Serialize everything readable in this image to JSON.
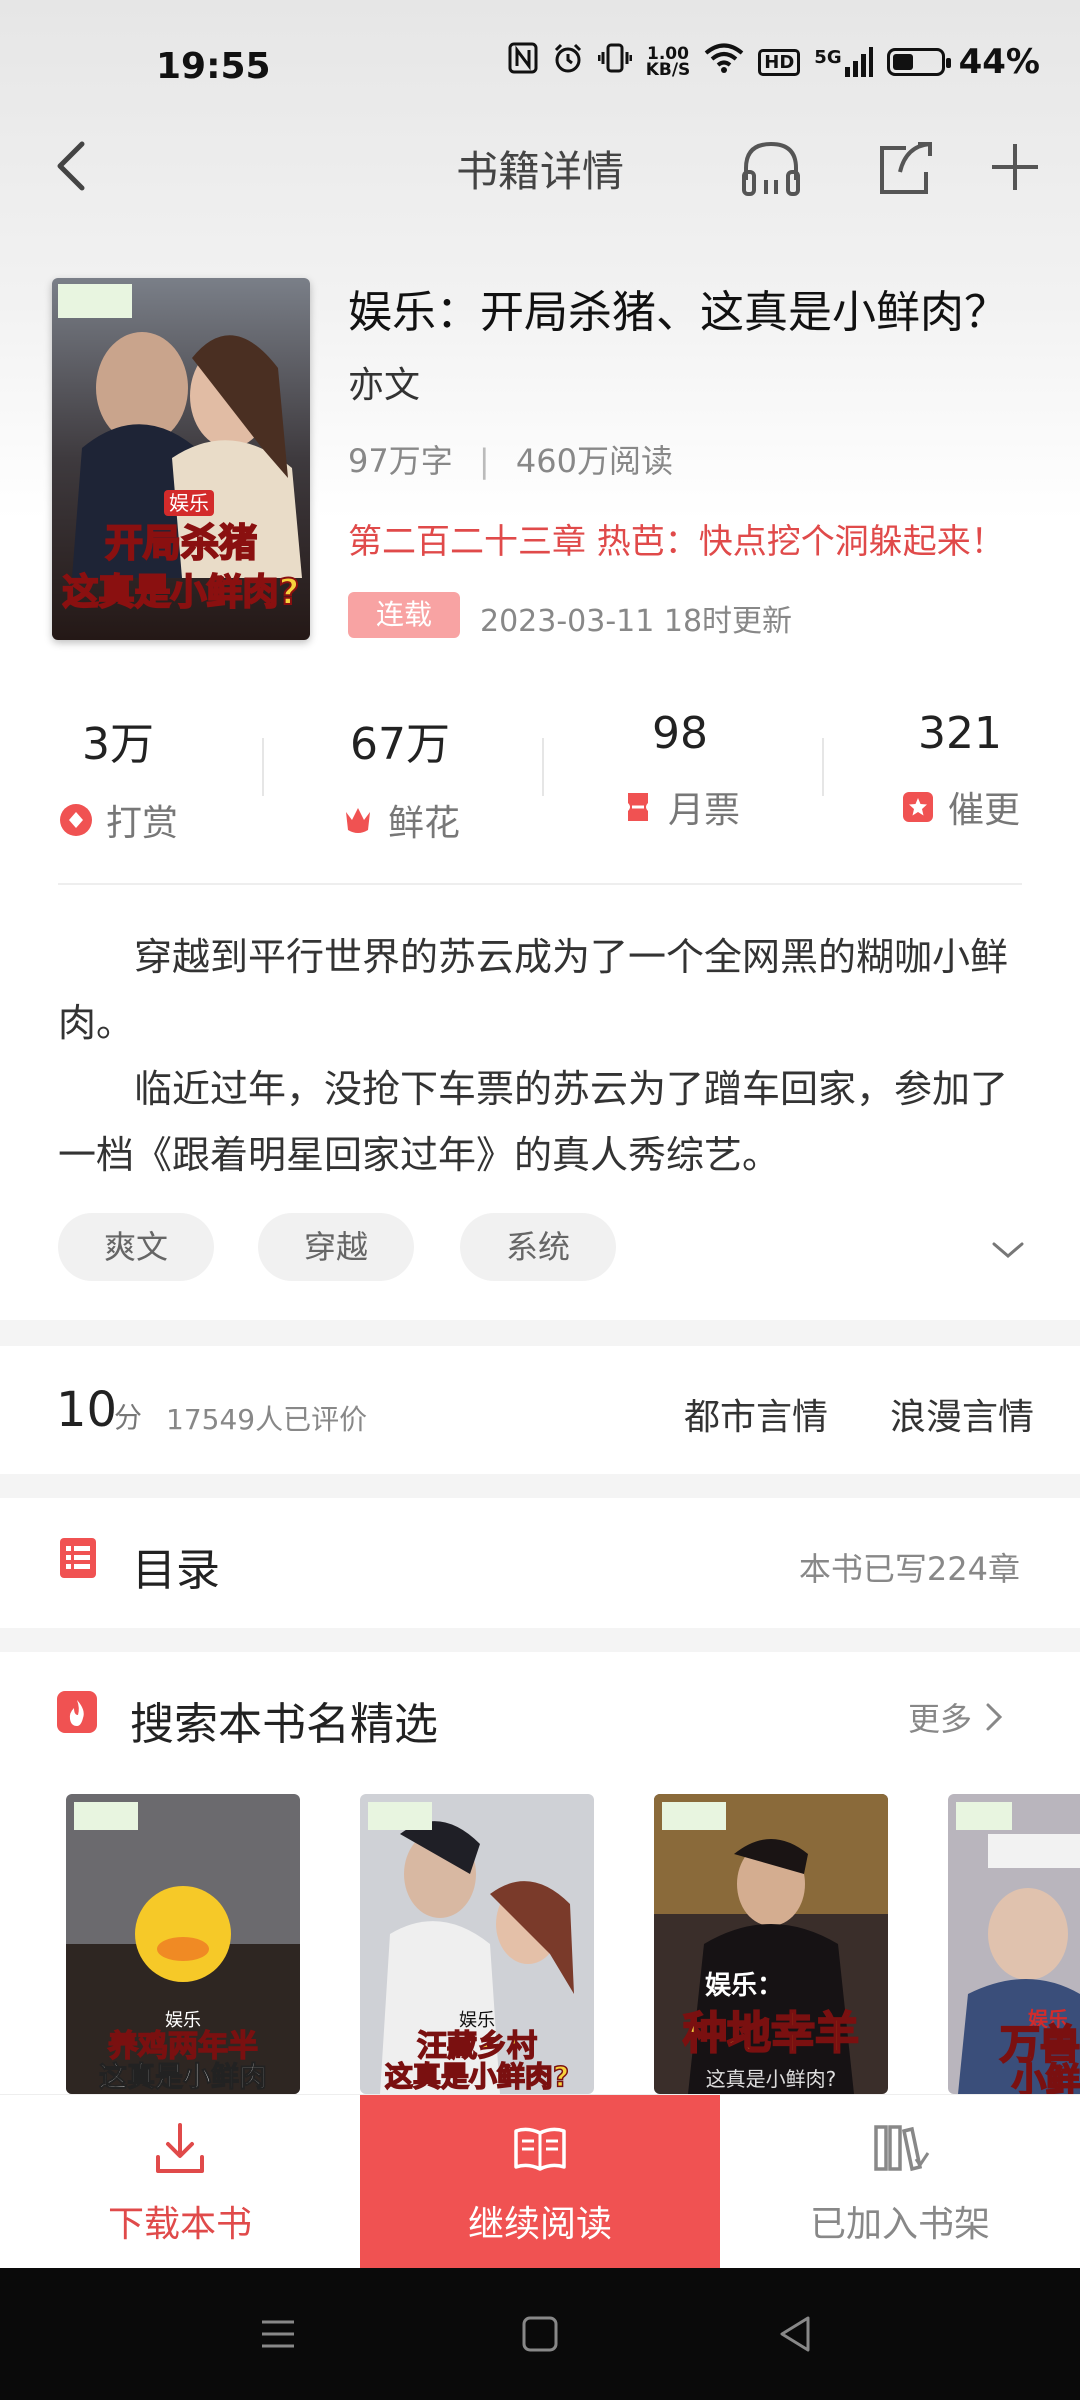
{
  "status_bar": {
    "time": "19:55",
    "net_speed": "1.00\nKB/S",
    "net_speed_top": "1.00",
    "net_speed_bottom": "KB/S",
    "hd": "HD",
    "signal": "5G",
    "battery_percent": "44%",
    "battery_level": 0.44
  },
  "nav": {
    "title": "书籍详情",
    "icons": [
      "back-icon",
      "headphones-icon",
      "share-icon",
      "add-icon"
    ]
  },
  "book": {
    "title": "娱乐：开局杀猪、这真是小鲜肉？",
    "author": "亦文",
    "word_count": "97万字",
    "reads": "460万阅读",
    "latest_chapter": "第二百二十三章 热芭：快点挖个洞躲起来！",
    "status_badge": "连载",
    "updated": "2023-03-11 18时更新",
    "cover_text_top": "娱乐",
    "cover_text_1": "开局杀猪",
    "cover_text_2": "这真是小鲜肉?"
  },
  "metrics": [
    {
      "value": "3万",
      "label": "打赏",
      "icon": "reward-icon"
    },
    {
      "value": "67万",
      "label": "鲜花",
      "icon": "flower-icon"
    },
    {
      "value": "98",
      "label": "月票",
      "icon": "ticket-icon"
    },
    {
      "value": "321",
      "label": "催更",
      "icon": "urge-icon"
    }
  ],
  "synopsis": [
    "穿越到平行世界的苏云成为了一个全网黑的糊咖小鲜肉。",
    "临近过年，没抢下车票的苏云为了蹭车回家，参加了一档《跟着明星回家过年》的真人秀综艺。"
  ],
  "tags": [
    "爽文",
    "穿越",
    "系统"
  ],
  "rating": {
    "score": "10",
    "unit": "分",
    "count": "17549人已评价",
    "categories": [
      "都市言情",
      "浪漫言情"
    ]
  },
  "toc": {
    "title": "目录",
    "info": "本书已写224章"
  },
  "recommend": {
    "title": "搜索本书名精选",
    "more": "更多",
    "books": [
      {
        "line1": "娱乐",
        "line2": "养鸡两年半",
        "line3": "这真是小鲜肉"
      },
      {
        "line1": "娱乐",
        "line2": "汪藏乡村",
        "line3": "这真是小鲜肉?"
      },
      {
        "line1": "娱乐：",
        "line2": "种地幸羊",
        "line3": "这真是小鲜肉?"
      },
      {
        "line1": "娱乐",
        "line2": "万兽",
        "line3": "小鲜"
      }
    ]
  },
  "bottom_bar": {
    "download": "下载本书",
    "read": "继续阅读",
    "shelf": "已加入书架"
  },
  "colors": {
    "accent": "#f05252",
    "accent_text": "#e04a4a",
    "badge": "#f8a3a3"
  }
}
